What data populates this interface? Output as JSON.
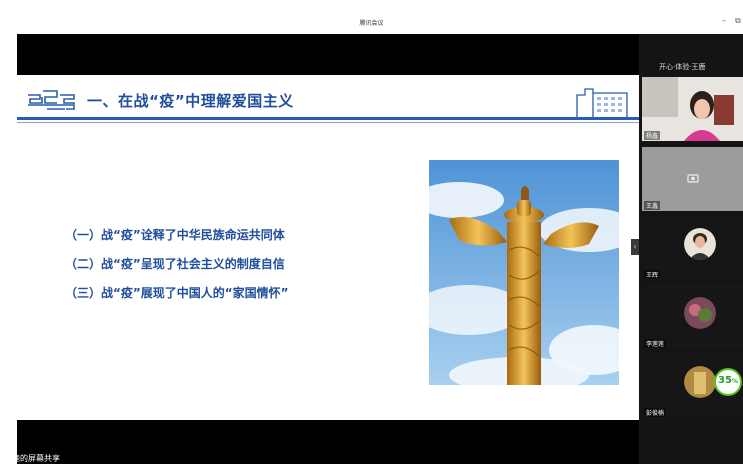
{
  "window": {
    "title": "腾讯会议",
    "minimize_glyph": "–",
    "restore_glyph": "⧉"
  },
  "slide": {
    "title": "一、在战“疫”中理解爱国主义",
    "points": [
      "（一）战“疫”诠释了中华民族命运共同体",
      "（二）战“疫”呈现了社会主义的制度自信",
      "（三）战“疫”展现了中国人的“家国情怀”"
    ],
    "accent": "#1f4e9c"
  },
  "share_bar": {
    "label": "土鹿的屏幕共享"
  },
  "panel": {
    "header": "开心·体验·王鹿",
    "participants": [
      {
        "name": "杨鑫"
      },
      {
        "name": "王鑫"
      },
      {
        "name": "王辉"
      },
      {
        "name": "李莲莲"
      },
      {
        "name": "彭俊楠"
      }
    ],
    "badge_value": "35",
    "badge_unit": "%"
  }
}
